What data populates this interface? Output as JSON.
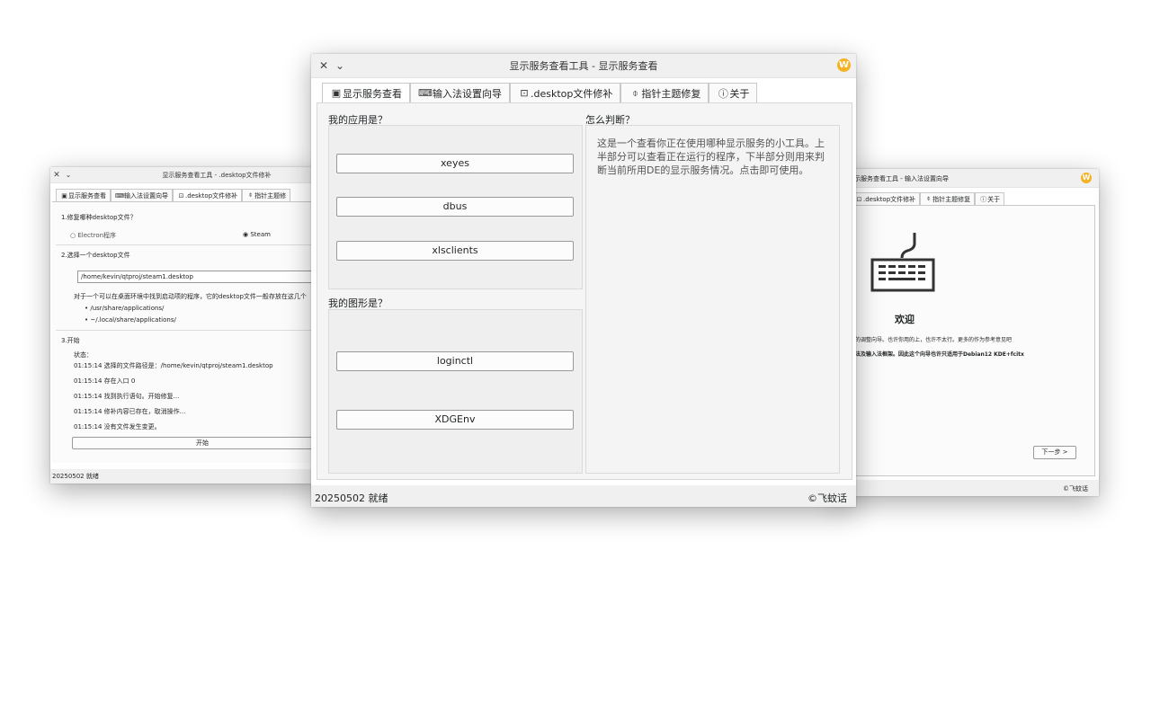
{
  "left_window": {
    "title": "显示服务查看工具 - .desktop文件修补",
    "tabs": [
      {
        "label": "显示服务查看",
        "icon": "monitor-icon"
      },
      {
        "label": "输入法设置向导",
        "icon": "keyboard-icon"
      },
      {
        "label": ".desktop文件修补",
        "icon": "file-icon"
      },
      {
        "label": "指针主题修",
        "icon": "pointer-icon"
      }
    ],
    "section1": "1.修复哪种desktop文件？",
    "radio_electron": "Electron程序",
    "radio_steam": "Steam",
    "section2": "2.选择一个desktop文件",
    "path_value": "/home/kevin/qtproj/steam1.desktop",
    "hint": "对于一个可以在桌面环境中找到启动项的程序，它的desktop文件一般存放在这几个",
    "paths": [
      "• /usr/share/applications/",
      "• ~/.local/share/applications/"
    ],
    "section3": "3.开始",
    "status_label": "状态：",
    "log": [
      "01:15:14 选择的文件路径是：/home/kevin/qtproj/steam1.desktop",
      "01:15:14 存在入口 0",
      "01:15:14 找到执行语句。开始修复...",
      "01:15:14 修补内容已存在，取消操作...",
      "01:15:14 没有文件发生变更。"
    ],
    "start_button": "开始",
    "status_text": "20250502 就绪"
  },
  "right_window": {
    "title": "示服务查看工具 - 输入法设置向导",
    "tabs": [
      {
        "label": ".desktop文件修补",
        "icon": "file-icon"
      },
      {
        "label": "指针主题修复",
        "icon": "pointer-icon"
      },
      {
        "label": "关于",
        "icon": "info-icon"
      }
    ],
    "welcome": "欢迎",
    "line1": "的调整向导。也许你用的上，也许不太行。更多的作为参考意见吧",
    "line2": "法及输入法框架。因此这个向导也许只适用于Debian12 KDE+fcitx",
    "next_button": "下一步 >",
    "copyright": "©飞蚊话"
  },
  "main_window": {
    "title": "显示服务查看工具 - 显示服务查看",
    "tabs": [
      {
        "label": "显示服务查看",
        "icon": "monitor-icon"
      },
      {
        "label": "输入法设置向导",
        "icon": "keyboard-icon"
      },
      {
        "label": ".desktop文件修补",
        "icon": "file-icon"
      },
      {
        "label": "指针主题修复",
        "icon": "pointer-icon"
      },
      {
        "label": "关于",
        "icon": "info-icon"
      }
    ],
    "app_question": "我的应用是？",
    "app_buttons": [
      "xeyes",
      "dbus",
      "xlsclients"
    ],
    "graphics_question": "我的图形是？",
    "graphics_buttons": [
      "loginctl",
      "XDGEnv"
    ],
    "judge_question": "怎么判断？",
    "description": "这是一个查看你正在使用哪种显示服务的小工具。上半部分可以查看正在运行的程序，下半部分则用来判断当前所用DE的显示服务情况。点击即可使用。",
    "status_text": "20250502 就绪",
    "copyright": "©飞蚊话"
  }
}
